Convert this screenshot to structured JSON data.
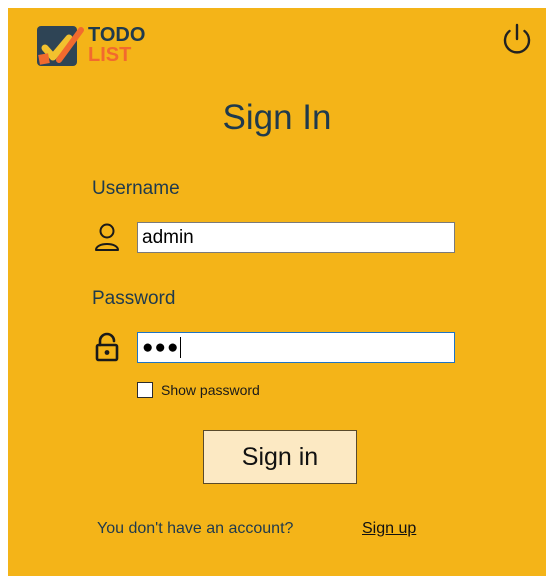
{
  "app": {
    "logo_line1": "TODO",
    "logo_line2": "LIST"
  },
  "page": {
    "title": "Sign In"
  },
  "form": {
    "username_label": "Username",
    "username_value": "admin",
    "password_label": "Password",
    "password_masked": "●●●",
    "show_password_label": "Show password",
    "show_password_checked": false,
    "submit_label": "Sign in"
  },
  "footer": {
    "prompt": "You don't have an account?",
    "signup_link": "Sign up"
  },
  "colors": {
    "background": "#F4B418",
    "title": "#1F3A4D",
    "logo_accent": "#F26A2E",
    "button_bg": "#FCE9C3",
    "focus_border": "#1E74C4"
  },
  "icons": {
    "logo": "todo-checkmark-logo",
    "power": "power-icon",
    "user": "user-icon",
    "lock": "lock-icon"
  }
}
